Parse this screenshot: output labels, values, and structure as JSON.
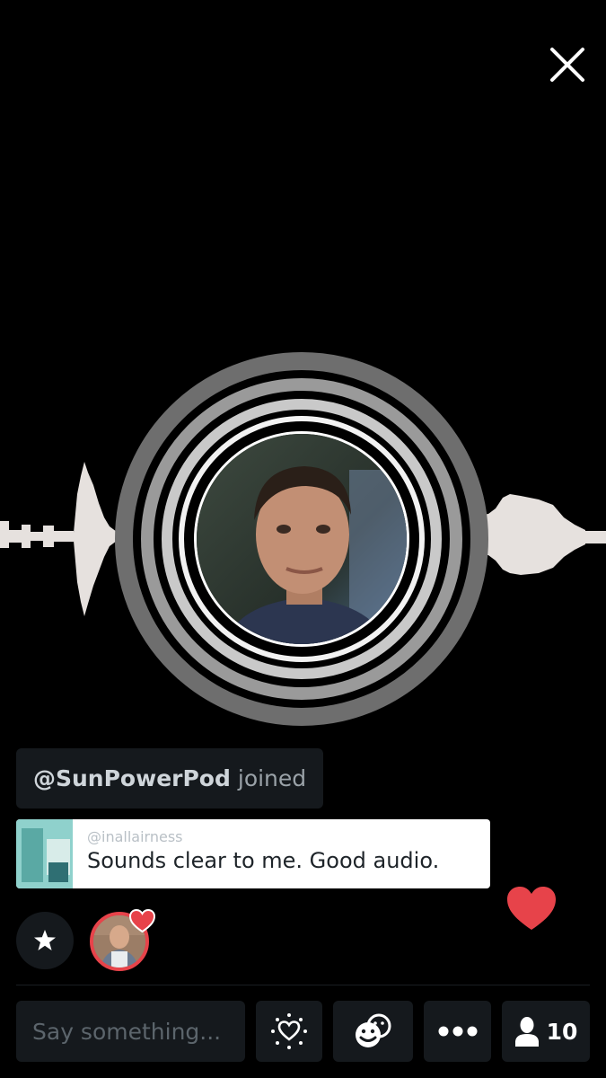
{
  "header": {
    "close_icon": "close-icon"
  },
  "broadcast": {
    "speaker_avatar_icon": "speaker-avatar"
  },
  "chat": {
    "join_event": {
      "username": "@SunPowerPod",
      "action": "joined"
    },
    "comment": {
      "handle": "@inallairness",
      "text": "Sounds clear to me. Good audio."
    }
  },
  "reactions": {
    "star_icon": "star-icon",
    "heart_color": "#e7434a"
  },
  "bottom_bar": {
    "input_placeholder": "Say something...",
    "heart_button_icon": "heart-sparkle-icon",
    "emoji_button_icon": "emoji-icon",
    "more_button_icon": "more-icon",
    "viewer_icon": "person-icon",
    "viewer_count": "10"
  },
  "colors": {
    "background": "#000000",
    "panel": "#15191d",
    "heart": "#e7434a",
    "waveform": "#e6e1de"
  }
}
